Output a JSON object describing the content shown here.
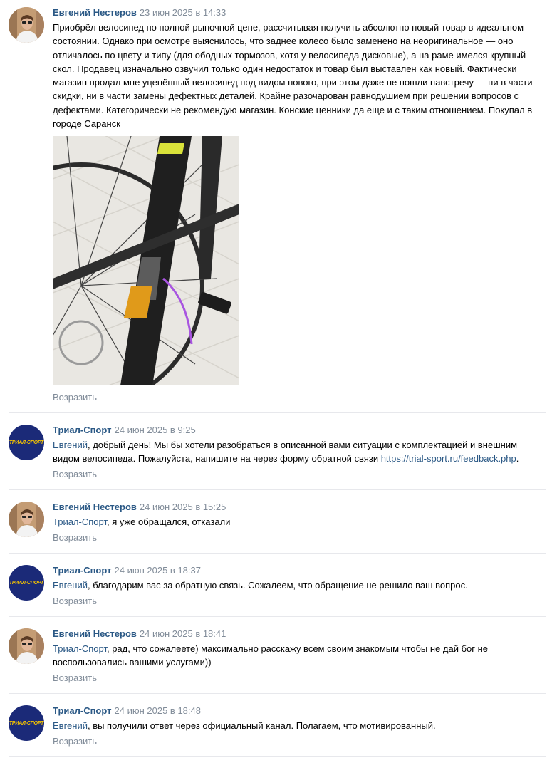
{
  "comments": [
    {
      "author": "Евгений Нестеров",
      "date": "23 июн 2025 в 14:33",
      "text": "Приобрёл велосипед по полной рыночной цене, рассчитывая получить абсолютно новый товар в идеальном состоянии. Однако при осмотре выяснилось, что заднее колесо было заменено на неоригинальное — оно отличалось по цвету и типу (для ободных тормозов, хотя у велосипеда дисковые), а на раме имелся крупный скол. Продавец изначально озвучил только один недостаток и товар был выставлен как новый. Фактически магазин продал мне уценённый велосипед под видом нового, при этом даже не пошли навстречу — ни в части скидки, ни в части замены дефектных деталей. Крайне разочарован равнодушием при решении вопросов с дефектами. Категорически не рекомендую магазин. Конские ценники да еще и с таким отношением. Покупал в городе Саранск",
      "reply": "Возразить"
    },
    {
      "author": "Триал-Спорт",
      "date": "24 июн 2025 в 9:25",
      "mention": "Евгений",
      "text": ", добрый день! Мы бы хотели разобраться в описанной вами ситуации с комплектацией и внешним видом велосипеда. Пожалуйста, напишите на через форму обратной связи ",
      "link": "https://trial-sport.ru/feedback.php",
      "text_end": ".",
      "reply": "Возразить"
    },
    {
      "author": "Евгений Нестеров",
      "date": "24 июн 2025 в 15:25",
      "mention": "Триал-Спорт",
      "text": ", я уже обращался, отказали",
      "reply": "Возразить"
    },
    {
      "author": "Триал-Спорт",
      "date": "24 июн 2025 в 18:37",
      "mention": "Евгений",
      "text": ", благодарим вас за обратную связь. Сожалеем, что обращение не решило ваш вопрос.",
      "reply": "Возразить"
    },
    {
      "author": "Евгений Нестеров",
      "date": "24 июн 2025 в 18:41",
      "mention": "Триал-Спорт",
      "text": ", рад, что сожалеете) максимально расскажу всем своим знакомым чтобы не дай бог не воспользовались вашими услугами))",
      "reply": "Возразить"
    },
    {
      "author": "Триал-Спорт",
      "date": "24 июн 2025 в 18:48",
      "mention": "Евгений",
      "text": ", вы получили ответ через официальный канал. Полагаем, что мотивированный.",
      "reply": "Возразить"
    }
  ],
  "brand_avatar_text": "ТРИАЛ-СПОРТ",
  "colors": {
    "link": "#2a5885",
    "meta": "#818c99",
    "separator": "#e7e8ec",
    "brand_bg": "#1b2a78",
    "brand_fg": "#f5c400"
  }
}
